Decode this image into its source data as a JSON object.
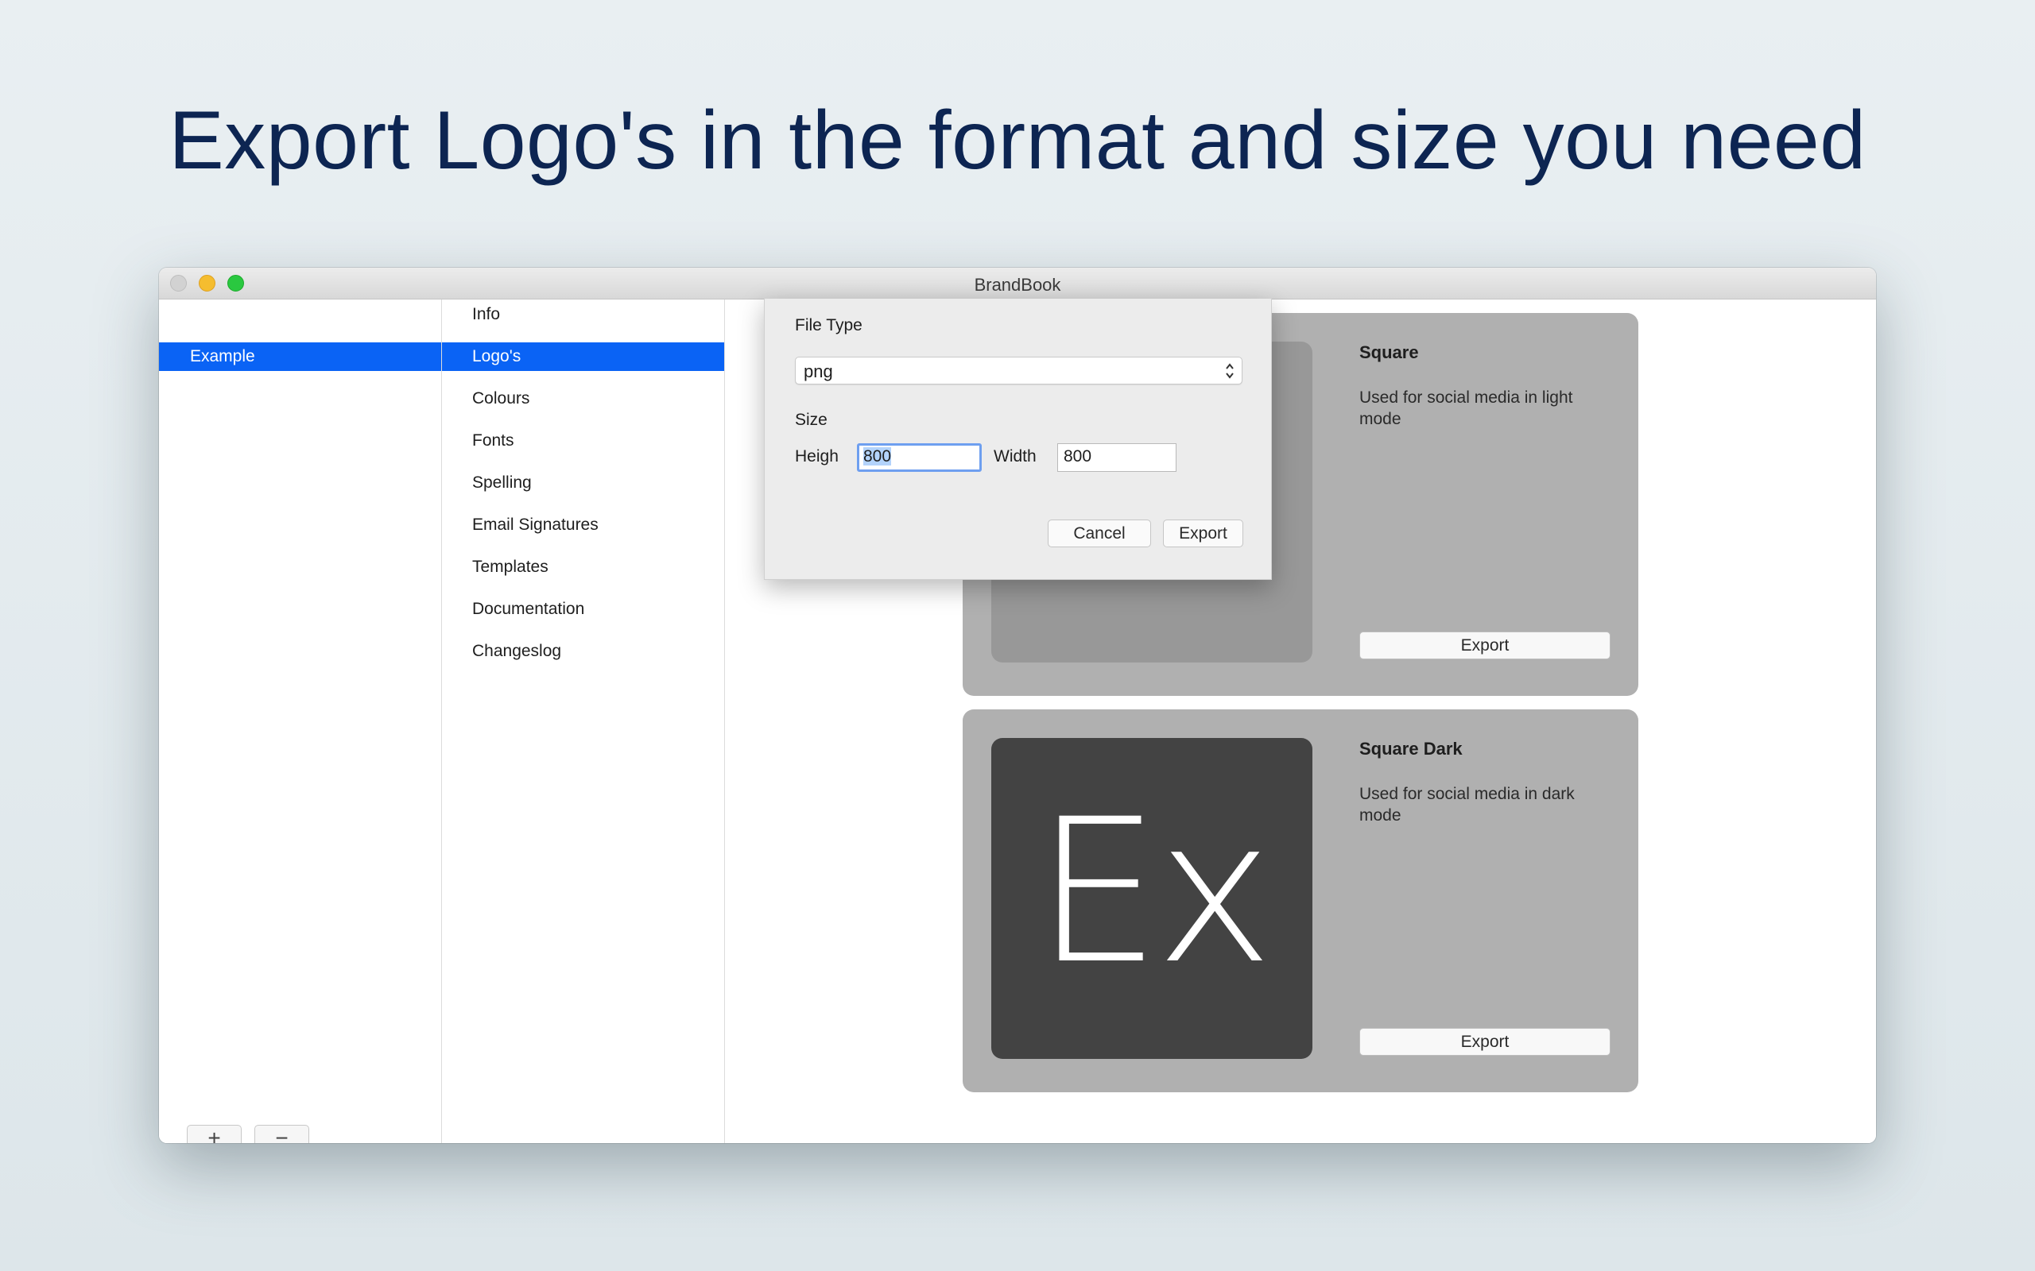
{
  "headline": "Export Logo's in the format and size you need",
  "window": {
    "title": "BrandBook"
  },
  "sidebar_brands": {
    "items": [
      {
        "label": "Example",
        "selected": true
      }
    ],
    "add_label": "+",
    "remove_label": "−"
  },
  "sidebar_sections": {
    "items": [
      {
        "label": "Info"
      },
      {
        "label": "Logo's",
        "selected": true
      },
      {
        "label": "Colours"
      },
      {
        "label": "Fonts"
      },
      {
        "label": "Spelling"
      },
      {
        "label": "Email Signatures"
      },
      {
        "label": "Templates"
      },
      {
        "label": "Documentation"
      },
      {
        "label": "Changeslog"
      }
    ]
  },
  "logos": [
    {
      "title": "Square",
      "description": "Used for social media in light mode",
      "export_label": "Export"
    },
    {
      "title": "Square Dark",
      "description": "Used for social media in dark mode",
      "export_label": "Export",
      "preview_text": "Ex"
    }
  ],
  "export_dialog": {
    "file_type_label": "File Type",
    "file_type_value": "png",
    "size_label": "Size",
    "height_label": "Heigh",
    "height_value": "800",
    "width_label": "Width",
    "width_value": "800",
    "cancel_label": "Cancel",
    "export_label": "Export"
  },
  "colors": {
    "accent": "#0a63f5",
    "headline": "#0d2552",
    "card_bg": "#b0b0b0",
    "dark_logo_bg": "#434343"
  }
}
